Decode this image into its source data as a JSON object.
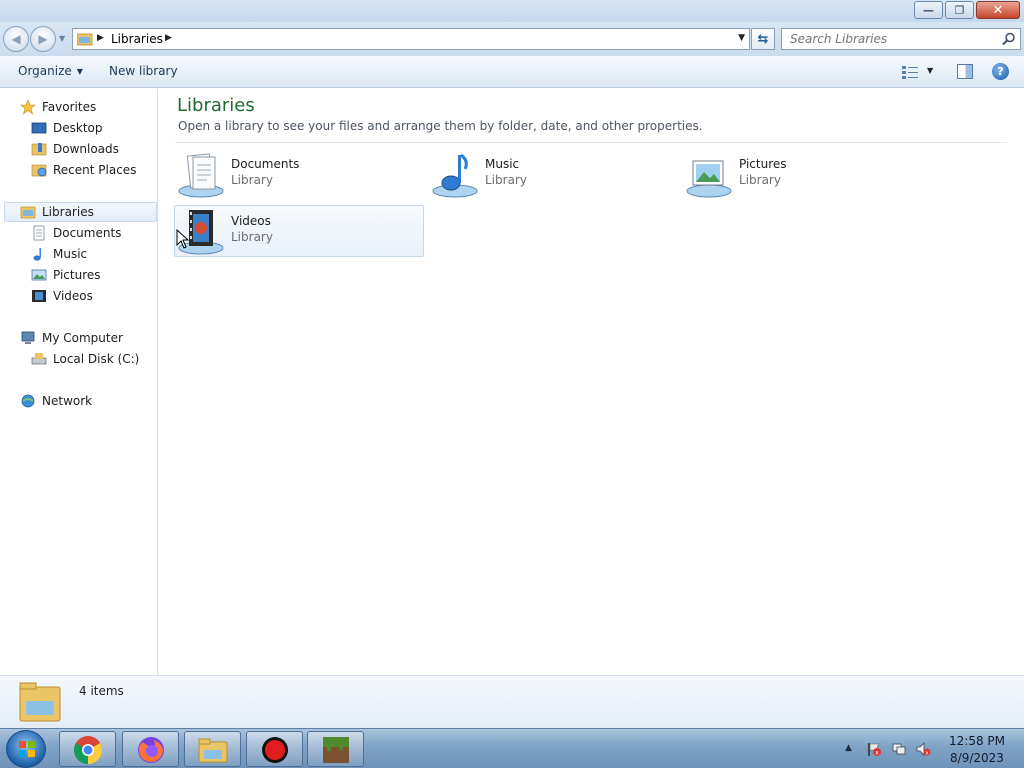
{
  "window": {
    "controls": {
      "minimize": "—",
      "maximize": "❐",
      "close": "✕"
    }
  },
  "address_bar": {
    "crumb": "Libraries",
    "search_placeholder": "Search Libraries"
  },
  "toolbar": {
    "organize": "Organize",
    "new_library": "New library"
  },
  "nav_pane": {
    "favorites": {
      "label": "Favorites",
      "items": [
        {
          "label": "Desktop",
          "icon": "desktop-icon"
        },
        {
          "label": "Downloads",
          "icon": "downloads-icon"
        },
        {
          "label": "Recent Places",
          "icon": "recent-places-icon"
        }
      ]
    },
    "libraries": {
      "label": "Libraries",
      "selected": true,
      "items": [
        {
          "label": "Documents",
          "icon": "documents-icon"
        },
        {
          "label": "Music",
          "icon": "music-icon"
        },
        {
          "label": "Pictures",
          "icon": "pictures-icon"
        },
        {
          "label": "Videos",
          "icon": "videos-icon"
        }
      ]
    },
    "computer": {
      "label": "My Computer",
      "items": [
        {
          "label": "Local Disk (C:)",
          "icon": "local-disk-icon"
        }
      ]
    },
    "network": {
      "label": "Network"
    }
  },
  "content": {
    "title": "Libraries",
    "subtitle": "Open a library to see your files and arrange them by folder, date, and other properties.",
    "libraries": [
      {
        "name": "Documents",
        "type": "Library",
        "icon": "documents-library-icon"
      },
      {
        "name": "Music",
        "type": "Library",
        "icon": "music-library-icon"
      },
      {
        "name": "Pictures",
        "type": "Library",
        "icon": "pictures-library-icon"
      },
      {
        "name": "Videos",
        "type": "Library",
        "icon": "videos-library-icon",
        "hovered": true
      }
    ]
  },
  "details": {
    "count": "4 items"
  },
  "taskbar": {
    "apps": [
      "chrome",
      "firefox",
      "explorer",
      "recorder",
      "minecraft"
    ],
    "clock": {
      "time": "12:58 PM",
      "date": "8/9/2023"
    }
  },
  "colors": {
    "title_green": "#1e6b2c",
    "link_blue": "#1e395b"
  }
}
